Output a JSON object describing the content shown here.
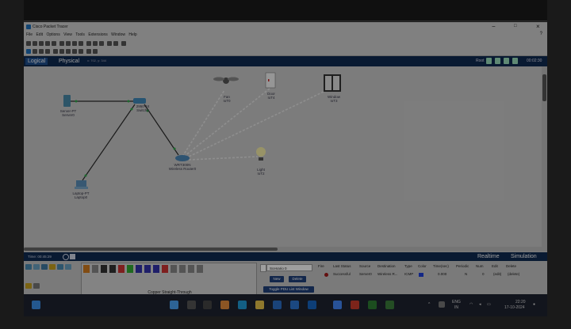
{
  "window": {
    "title": "Cisco Packet Tracer"
  },
  "menu": [
    "File",
    "Edit",
    "Options",
    "View",
    "Tools",
    "Extensions",
    "Window",
    "Help"
  ],
  "help_label": "?",
  "tabs": {
    "logical": "Logical",
    "physical": "Physical",
    "coords": "x: 702, y: 344"
  },
  "workspace_right": {
    "root": "Root",
    "clock": "00:02:30"
  },
  "devices": [
    {
      "id": "server",
      "name": "Server-PT",
      "label": "Server0"
    },
    {
      "id": "switch",
      "name": "2950-24",
      "label": "Switch0"
    },
    {
      "id": "laptop",
      "name": "Laptop-PT",
      "label": "Laptop0"
    },
    {
      "id": "router",
      "name": "WRT300N",
      "label": "Wireless Router0"
    },
    {
      "id": "fan",
      "name": "Fan",
      "label": "IoT0"
    },
    {
      "id": "door",
      "name": "Door",
      "label": "IoT4"
    },
    {
      "id": "window",
      "name": "Window",
      "label": "IoT3"
    },
    {
      "id": "light",
      "name": "Light",
      "label": "IoT2"
    }
  ],
  "modebar": {
    "time": "Time: 00:45:29",
    "realtime": "Realtime",
    "simulation": "Simulation"
  },
  "bottom": {
    "device_selected_label": "Copper Straight-Through",
    "scenario": "Scenario 0",
    "new_button": "New",
    "delete_button": "Delete",
    "toggle_button": "Toggle PDU List Window",
    "pdu_headers": [
      "Fire",
      "Last Status",
      "Source",
      "Destination",
      "Type",
      "Color",
      "Time(sec)",
      "Periodic",
      "Num",
      "Edit",
      "Delete"
    ],
    "pdu_row": [
      "",
      "Successful",
      "Server0",
      "Wireless R...",
      "ICMP",
      "",
      "0.000",
      "N",
      "0",
      "(edit)",
      "(delete)"
    ]
  },
  "taskbar": {
    "lang": "ENG",
    "region": "IN",
    "time": "22:20",
    "date": "17-10-2024"
  },
  "colors": {
    "link": "#2a2a2a",
    "wireless": "#dcdcdc",
    "tabbar": "#0f2a52",
    "accent": "#1f4f8f"
  }
}
